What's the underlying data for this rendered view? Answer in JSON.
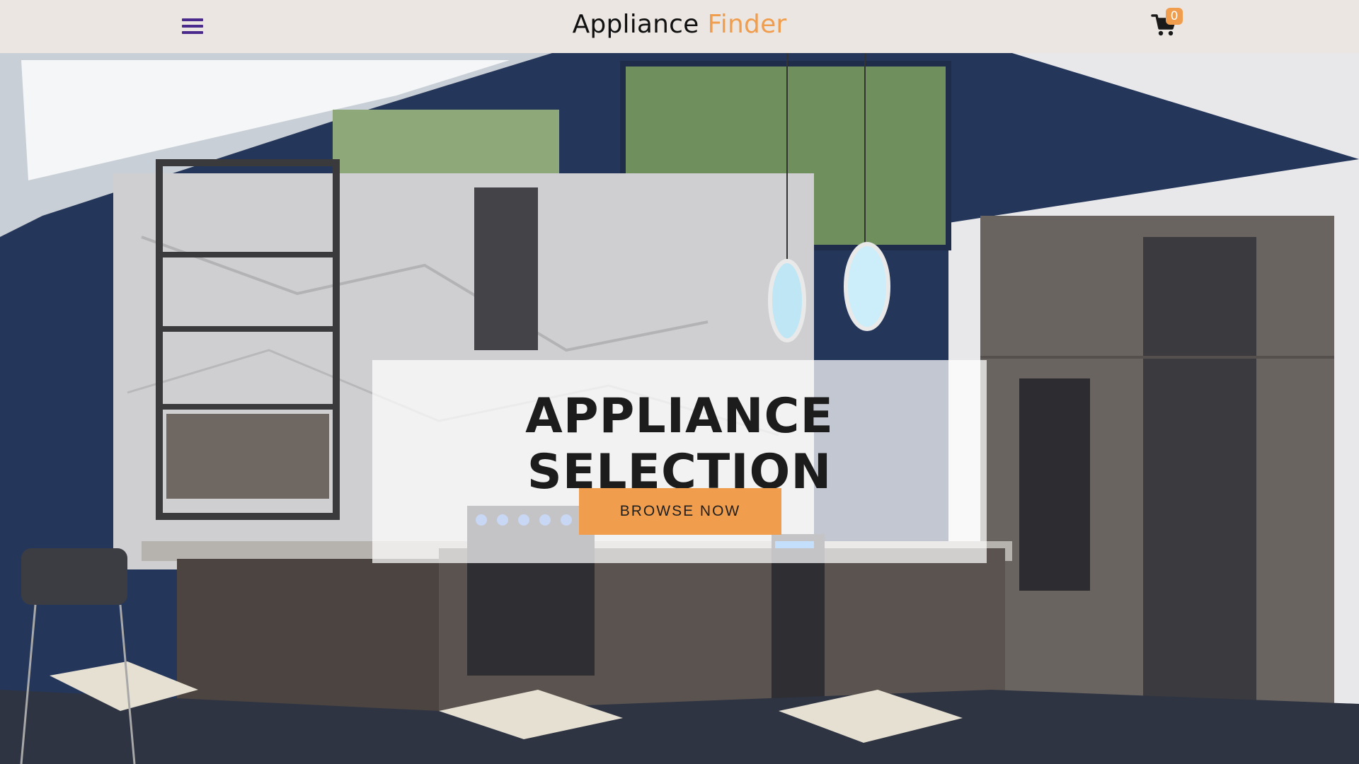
{
  "header": {
    "brand_part1": "Appliance",
    "brand_part2": "Finder",
    "cart_count": "0",
    "menu_icon": "hamburger-menu-icon",
    "cart_icon": "shopping-cart-icon"
  },
  "hero": {
    "title": "APPLIANCE SELECTION",
    "cta_label": "BROWSE NOW"
  },
  "colors": {
    "accent": "#f09e4e",
    "menu_icon": "#4a2a8c",
    "header_bg": "#ebe6e2"
  }
}
